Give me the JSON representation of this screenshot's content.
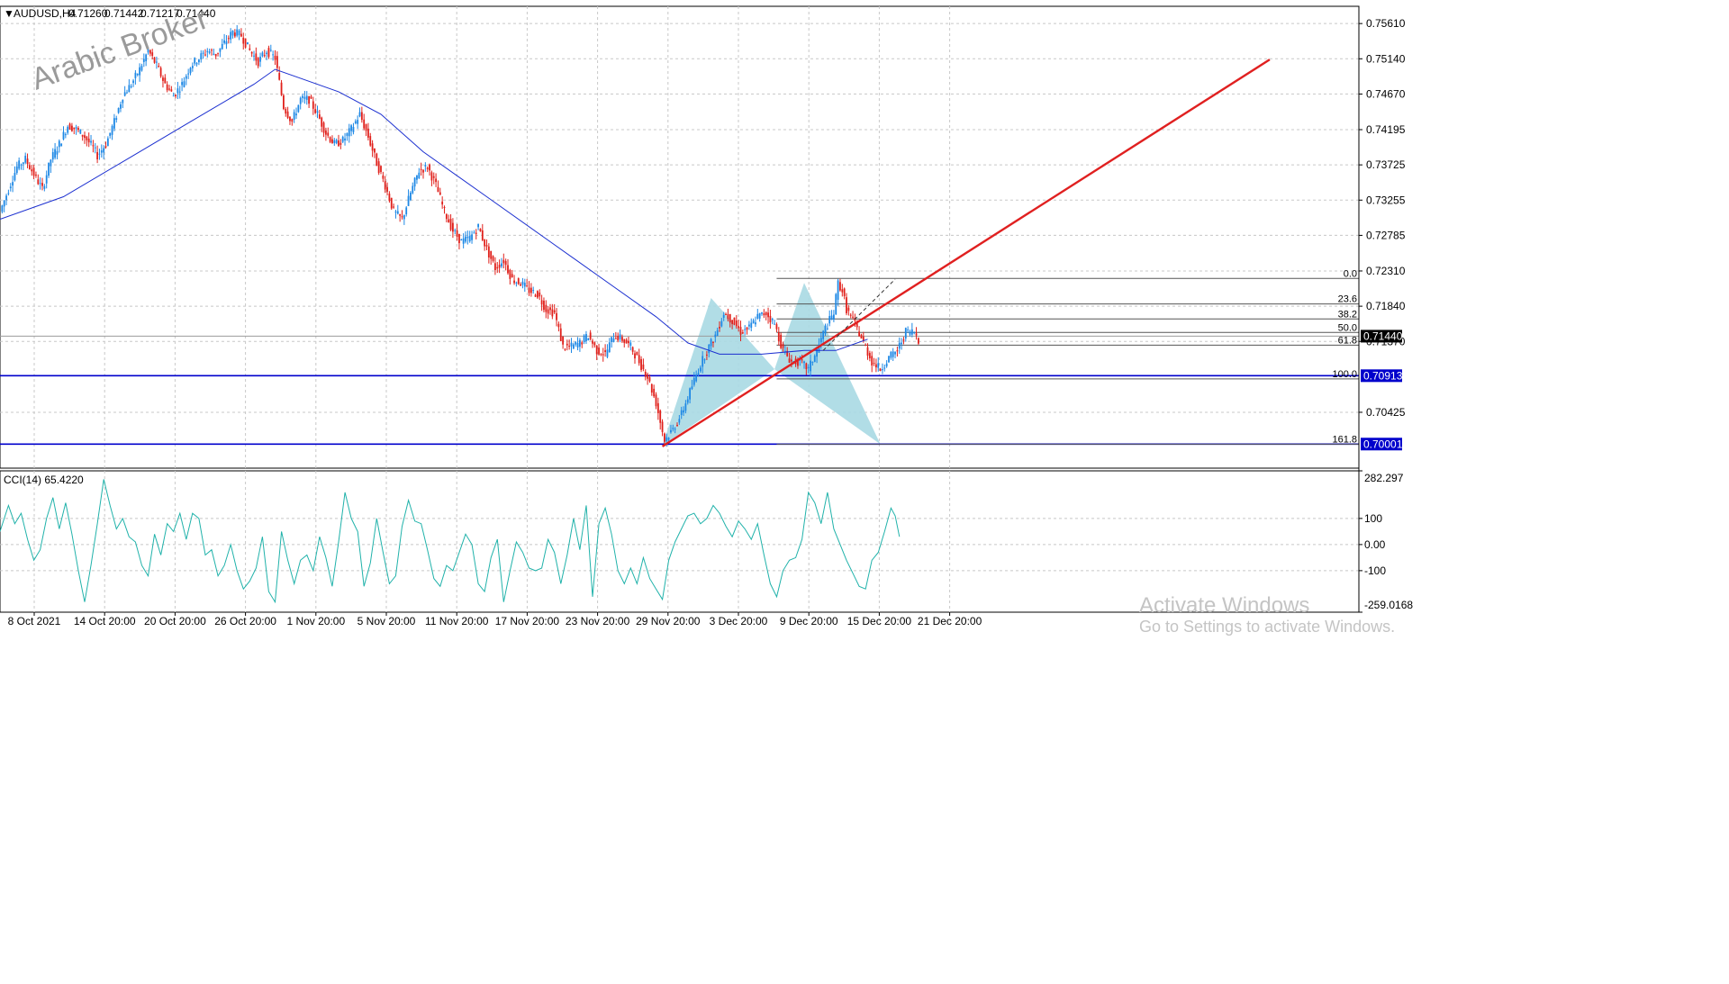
{
  "chart_data": {
    "type": "candlestick",
    "symbol_header": "AUDUSD,H4",
    "ohlc_header": [
      "0.71260",
      "0.71442",
      "0.71217",
      "0.71440"
    ],
    "watermark": "Arabic Broker",
    "price_ylim": [
      0.6968,
      0.7584
    ],
    "price_ticks": [
      "0.75610",
      "0.75140",
      "0.74670",
      "0.74195",
      "0.73725",
      "0.73255",
      "0.72785",
      "0.72310",
      "0.71840",
      "0.71370",
      "0.70425"
    ],
    "price_tags": [
      {
        "label": "0.71440",
        "value": 0.7144,
        "color": "#000000"
      },
      {
        "label": "0.70913",
        "value": 0.70913,
        "color": "#0000cc"
      },
      {
        "label": "0.70001",
        "value": 0.70001,
        "color": "#0000cc"
      }
    ],
    "x_labels": [
      "8 Oct 2021",
      "14 Oct 20:00",
      "20 Oct 20:00",
      "26 Oct 20:00",
      "1 Nov 20:00",
      "5 Nov 20:00",
      "11 Nov 20:00",
      "17 Nov 20:00",
      "23 Nov 20:00",
      "29 Nov 20:00",
      "3 Dec 20:00",
      "9 Dec 20:00",
      "15 Dec 20:00",
      "21 Dec 20:00"
    ],
    "close_path": [
      [
        0,
        0.731
      ],
      [
        4,
        0.734
      ],
      [
        8,
        0.737
      ],
      [
        12,
        0.738
      ],
      [
        16,
        0.736
      ],
      [
        20,
        0.734
      ],
      [
        24,
        0.738
      ],
      [
        28,
        0.74
      ],
      [
        32,
        0.7425
      ],
      [
        36,
        0.742
      ],
      [
        40,
        0.741
      ],
      [
        44,
        0.7395
      ],
      [
        46,
        0.7385
      ],
      [
        50,
        0.74
      ],
      [
        54,
        0.743
      ],
      [
        58,
        0.7465
      ],
      [
        62,
        0.748
      ],
      [
        66,
        0.75
      ],
      [
        70,
        0.7525
      ],
      [
        74,
        0.7505
      ],
      [
        78,
        0.748
      ],
      [
        82,
        0.7465
      ],
      [
        86,
        0.748
      ],
      [
        90,
        0.7505
      ],
      [
        94,
        0.7515
      ],
      [
        98,
        0.7525
      ],
      [
        102,
        0.752
      ],
      [
        106,
        0.7535
      ],
      [
        110,
        0.755
      ],
      [
        114,
        0.7545
      ],
      [
        118,
        0.7525
      ],
      [
        122,
        0.751
      ],
      [
        126,
        0.7525
      ],
      [
        130,
        0.7515
      ],
      [
        134,
        0.745
      ],
      [
        138,
        0.743
      ],
      [
        142,
        0.746
      ],
      [
        146,
        0.746
      ],
      [
        150,
        0.744
      ],
      [
        154,
        0.7415
      ],
      [
        158,
        0.74
      ],
      [
        162,
        0.7405
      ],
      [
        166,
        0.742
      ],
      [
        170,
        0.744
      ],
      [
        174,
        0.741
      ],
      [
        178,
        0.7375
      ],
      [
        182,
        0.7345
      ],
      [
        186,
        0.731
      ],
      [
        190,
        0.73
      ],
      [
        194,
        0.7335
      ],
      [
        198,
        0.7365
      ],
      [
        202,
        0.737
      ],
      [
        206,
        0.7345
      ],
      [
        210,
        0.731
      ],
      [
        214,
        0.7285
      ],
      [
        218,
        0.727
      ],
      [
        222,
        0.7275
      ],
      [
        226,
        0.729
      ],
      [
        230,
        0.726
      ],
      [
        234,
        0.7235
      ],
      [
        238,
        0.7245
      ],
      [
        242,
        0.722
      ],
      [
        246,
        0.7215
      ],
      [
        250,
        0.7205
      ],
      [
        254,
        0.72
      ],
      [
        258,
        0.718
      ],
      [
        262,
        0.7175
      ],
      [
        266,
        0.713
      ],
      [
        270,
        0.713
      ],
      [
        274,
        0.7135
      ],
      [
        278,
        0.7145
      ],
      [
        282,
        0.7125
      ],
      [
        286,
        0.712
      ],
      [
        290,
        0.7145
      ],
      [
        294,
        0.714
      ],
      [
        298,
        0.713
      ],
      [
        302,
        0.711
      ],
      [
        306,
        0.709
      ],
      [
        310,
        0.7055
      ],
      [
        314,
        0.7005
      ],
      [
        318,
        0.702
      ],
      [
        322,
        0.704
      ],
      [
        326,
        0.707
      ],
      [
        330,
        0.71
      ],
      [
        334,
        0.7125
      ],
      [
        338,
        0.7145
      ],
      [
        342,
        0.7175
      ],
      [
        346,
        0.7165
      ],
      [
        350,
        0.715
      ],
      [
        354,
        0.7155
      ],
      [
        358,
        0.717
      ],
      [
        362,
        0.7175
      ],
      [
        366,
        0.716
      ],
      [
        370,
        0.7125
      ],
      [
        374,
        0.711
      ],
      [
        378,
        0.711
      ],
      [
        382,
        0.71
      ],
      [
        386,
        0.7125
      ],
      [
        390,
        0.7155
      ],
      [
        394,
        0.7175
      ],
      [
        396,
        0.7215
      ],
      [
        398,
        0.7205
      ],
      [
        400,
        0.718
      ],
      [
        404,
        0.716
      ],
      [
        408,
        0.7135
      ],
      [
        412,
        0.711
      ],
      [
        416,
        0.71
      ],
      [
        420,
        0.7115
      ],
      [
        424,
        0.7125
      ],
      [
        428,
        0.715
      ],
      [
        432,
        0.715
      ],
      [
        434,
        0.714
      ]
    ],
    "moving_average": [
      [
        0,
        0.73
      ],
      [
        30,
        0.733
      ],
      [
        60,
        0.738
      ],
      [
        90,
        0.743
      ],
      [
        120,
        0.748
      ],
      [
        130,
        0.75
      ],
      [
        140,
        0.749
      ],
      [
        160,
        0.747
      ],
      [
        180,
        0.744
      ],
      [
        200,
        0.739
      ],
      [
        230,
        0.733
      ],
      [
        260,
        0.727
      ],
      [
        290,
        0.721
      ],
      [
        310,
        0.717
      ],
      [
        325,
        0.7135
      ],
      [
        340,
        0.712
      ],
      [
        360,
        0.712
      ],
      [
        380,
        0.7125
      ],
      [
        395,
        0.7125
      ],
      [
        410,
        0.714
      ]
    ],
    "ma_period_unlabeled": true,
    "trendline": {
      "from": [
        313,
        0.6997
      ],
      "to": [
        600,
        0.7513
      ],
      "color": "#e02020"
    },
    "dashed_projection": {
      "from": [
        389,
        0.7125
      ],
      "to": [
        423,
        0.722
      ]
    },
    "harmonic_pattern": {
      "points": [
        [
          313,
          0.6998
        ],
        [
          336,
          0.7195
        ],
        [
          366,
          0.71
        ],
        [
          380,
          0.7215
        ],
        [
          416,
          0.7
        ]
      ],
      "fill": "#a9d9e3"
    },
    "fibonacci": {
      "x_start": 367,
      "levels": [
        {
          "label": "0.0",
          "value": 0.7221
        },
        {
          "label": "23.6",
          "value": 0.7187
        },
        {
          "label": "38.2",
          "value": 0.7167
        },
        {
          "label": "50.0",
          "value": 0.7149
        },
        {
          "label": "61.8",
          "value": 0.7132
        },
        {
          "label": "100.0",
          "value": 0.7087
        },
        {
          "label": "161.8",
          "value": 0.7
        }
      ]
    },
    "horizontal_lines": [
      {
        "value": 0.70913,
        "color": "#0000cc"
      },
      {
        "value": 0.70001,
        "color": "#0000cc"
      },
      {
        "value": 0.7144,
        "color": "#9c9c9c"
      }
    ],
    "cci": {
      "header": "CCI(14) 65.4220",
      "ylim": [
        -259.0168,
        282.297
      ],
      "ticks": [
        "282.297",
        "100",
        "0.00",
        "-100",
        "-259.0168"
      ],
      "values": [
        [
          0,
          50
        ],
        [
          4,
          150
        ],
        [
          7,
          80
        ],
        [
          10,
          120
        ],
        [
          13,
          20
        ],
        [
          16,
          -60
        ],
        [
          19,
          -20
        ],
        [
          22,
          100
        ],
        [
          25,
          180
        ],
        [
          28,
          60
        ],
        [
          31,
          160
        ],
        [
          34,
          40
        ],
        [
          37,
          -100
        ],
        [
          40,
          -220
        ],
        [
          43,
          -80
        ],
        [
          46,
          80
        ],
        [
          49,
          250
        ],
        [
          52,
          150
        ],
        [
          55,
          60
        ],
        [
          58,
          100
        ],
        [
          61,
          30
        ],
        [
          64,
          10
        ],
        [
          67,
          -80
        ],
        [
          70,
          -120
        ],
        [
          73,
          40
        ],
        [
          76,
          -40
        ],
        [
          79,
          80
        ],
        [
          82,
          50
        ],
        [
          85,
          120
        ],
        [
          88,
          20
        ],
        [
          91,
          120
        ],
        [
          94,
          100
        ],
        [
          97,
          -40
        ],
        [
          100,
          -20
        ],
        [
          103,
          -120
        ],
        [
          106,
          -80
        ],
        [
          109,
          0
        ],
        [
          112,
          -100
        ],
        [
          115,
          -170
        ],
        [
          118,
          -140
        ],
        [
          121,
          -90
        ],
        [
          124,
          30
        ],
        [
          127,
          -180
        ],
        [
          130,
          -220
        ],
        [
          133,
          50
        ],
        [
          136,
          -60
        ],
        [
          139,
          -150
        ],
        [
          142,
          -60
        ],
        [
          145,
          -40
        ],
        [
          148,
          -100
        ],
        [
          151,
          30
        ],
        [
          154,
          -50
        ],
        [
          157,
          -160
        ],
        [
          160,
          10
        ],
        [
          163,
          200
        ],
        [
          166,
          100
        ],
        [
          169,
          50
        ],
        [
          172,
          -160
        ],
        [
          175,
          -70
        ],
        [
          178,
          100
        ],
        [
          181,
          -30
        ],
        [
          184,
          -150
        ],
        [
          187,
          -120
        ],
        [
          190,
          70
        ],
        [
          193,
          170
        ],
        [
          196,
          90
        ],
        [
          199,
          80
        ],
        [
          202,
          -20
        ],
        [
          205,
          -130
        ],
        [
          208,
          -160
        ],
        [
          211,
          -80
        ],
        [
          214,
          -100
        ],
        [
          217,
          -30
        ],
        [
          220,
          40
        ],
        [
          223,
          0
        ],
        [
          226,
          -150
        ],
        [
          229,
          -180
        ],
        [
          232,
          -50
        ],
        [
          235,
          20
        ],
        [
          238,
          -220
        ],
        [
          241,
          -100
        ],
        [
          244,
          10
        ],
        [
          247,
          -30
        ],
        [
          250,
          -90
        ],
        [
          253,
          -100
        ],
        [
          256,
          -90
        ],
        [
          259,
          20
        ],
        [
          262,
          -30
        ],
        [
          265,
          -150
        ],
        [
          268,
          -40
        ],
        [
          271,
          100
        ],
        [
          274,
          -20
        ],
        [
          277,
          150
        ],
        [
          280,
          -200
        ],
        [
          283,
          80
        ],
        [
          286,
          140
        ],
        [
          289,
          40
        ],
        [
          292,
          -100
        ],
        [
          295,
          -150
        ],
        [
          298,
          -90
        ],
        [
          301,
          -150
        ],
        [
          304,
          -50
        ],
        [
          307,
          -130
        ],
        [
          310,
          -170
        ],
        [
          313,
          -210
        ],
        [
          316,
          -60
        ],
        [
          319,
          10
        ],
        [
          322,
          60
        ],
        [
          325,
          110
        ],
        [
          328,
          120
        ],
        [
          331,
          80
        ],
        [
          334,
          100
        ],
        [
          337,
          150
        ],
        [
          340,
          120
        ],
        [
          343,
          70
        ],
        [
          346,
          30
        ],
        [
          349,
          90
        ],
        [
          352,
          60
        ],
        [
          355,
          20
        ],
        [
          358,
          80
        ],
        [
          361,
          -40
        ],
        [
          364,
          -150
        ],
        [
          367,
          -200
        ],
        [
          370,
          -100
        ],
        [
          373,
          -60
        ],
        [
          376,
          -50
        ],
        [
          379,
          20
        ],
        [
          382,
          200
        ],
        [
          385,
          160
        ],
        [
          388,
          80
        ],
        [
          391,
          200
        ],
        [
          394,
          60
        ],
        [
          397,
          0
        ],
        [
          400,
          -60
        ],
        [
          403,
          -110
        ],
        [
          406,
          -160
        ],
        [
          409,
          -170
        ],
        [
          412,
          -60
        ],
        [
          415,
          -30
        ],
        [
          418,
          50
        ],
        [
          421,
          140
        ],
        [
          423,
          110
        ],
        [
          425,
          30
        ]
      ]
    }
  },
  "overlay": {
    "activate_line1": "Activate Windows",
    "activate_line2": "Go to Settings to activate Windows."
  }
}
